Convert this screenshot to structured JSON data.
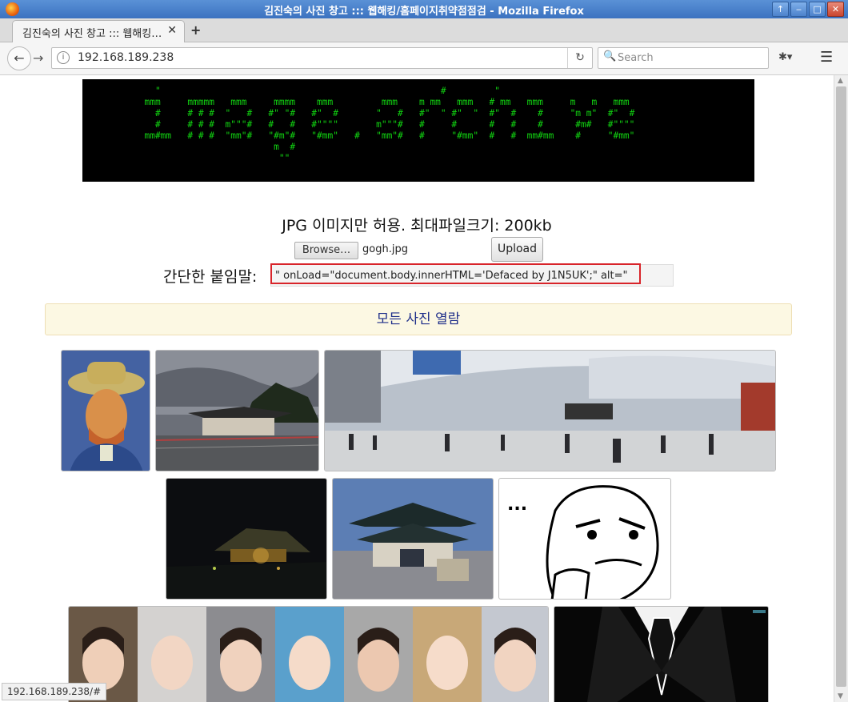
{
  "window": {
    "title": "김진숙의 사진 창고 ::: 웹해킹/홈페이지취약점점검 - Mozilla Firefox",
    "controls": [
      "↑",
      "‒",
      "□",
      "✕"
    ]
  },
  "tab": {
    "title": "김진숙의 사진 창고 ::: 웹해킹…",
    "close": "✕",
    "new_tab": "+"
  },
  "nav": {
    "back_icon": "←",
    "forward_icon": "→",
    "info_icon": "i",
    "url": "192.168.189.238",
    "reload_icon": "↻",
    "search_icon": "🔍",
    "search_placeholder": "Search",
    "ext_icon": "✱▾",
    "menu_icon": "☰"
  },
  "banner": {
    "ascii": "    \"                                                    #         \"         \n  mmm     mmmmm   mmm     mmmm    mmm         mmm    m mm   mmm   # mm   mmm     m   m   mmm  \n    #     # # #  \"   #   #\" \"#   #\"  #       \"   #   #\"  \" #\"  \"  #\"  #    #     \"m m\"  #\"  # \n    #     # # #  m\"\"\"#   #   #   #\"\"\"\"       m\"\"\"#   #     #      #   #    #      #m#   #\"\"\"\" \n  mm#mm   # # #  \"mm\"#   \"#m\"#   \"#mm\"   #   \"mm\"#   #     \"#mm\"  #   #  mm#mm    #     \"#mm\" \n                          m  #                                                                 \n                           \"\"                                                                  ",
    "color": "#11d411"
  },
  "upload": {
    "notice": "JPG 이미지만 허용. 최대파일크기: 200kb",
    "browse_label": "Browse…",
    "filename": "gogh.jpg",
    "upload_label": "Upload",
    "caption_label": "간단한 붙임말:",
    "caption_value": "\" onLoad=\"document.body.innerHTML='Defaced by J1N5UK';\" alt=\""
  },
  "gallery": {
    "view_all_label": "모든 사진 열람",
    "images": [
      {
        "name": "gogh-portrait"
      },
      {
        "name": "korean-traditional-building"
      },
      {
        "name": "train-station-panorama"
      },
      {
        "name": "palace-at-night"
      },
      {
        "name": "gyeongbokgung-gate"
      },
      {
        "name": "thinking-meme",
        "text": "..."
      },
      {
        "name": "idol-face-collage"
      },
      {
        "name": "suit-and-tie"
      }
    ]
  },
  "status": {
    "link": "192.168.189.238/#"
  }
}
